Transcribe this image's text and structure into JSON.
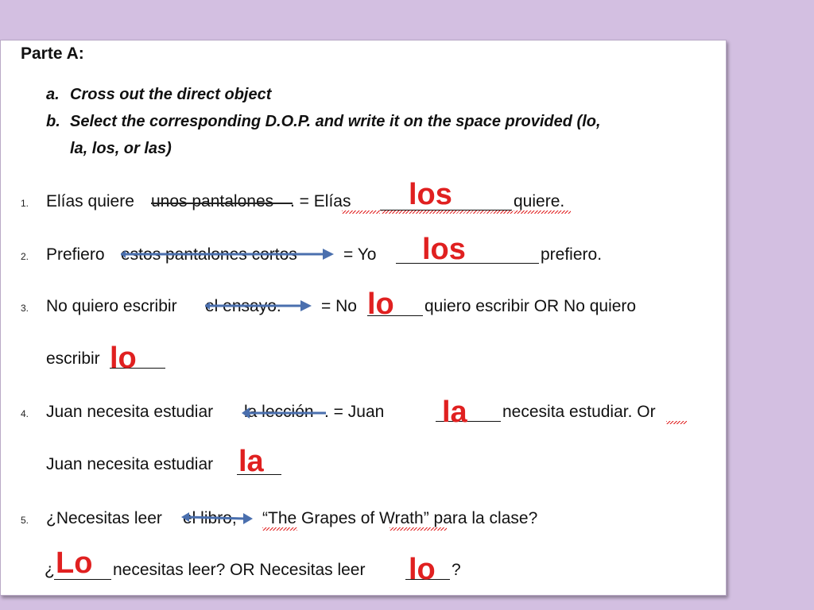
{
  "worksheet": {
    "heading": "Parte A:",
    "instructions": [
      {
        "label": "a.",
        "text": "Cross out the direct object"
      },
      {
        "label": "b.",
        "text": "Select the corresponding D.O.P. and write it on the space provided (lo,"
      },
      {
        "label": "",
        "text": "la, los, or las)"
      }
    ],
    "items": [
      {
        "number": "1.",
        "before": "Elías quiere",
        "struck": "unos pantalones",
        "after": ".  =   Elías",
        "tail": "quiere.",
        "answer": "los"
      },
      {
        "number": "2.",
        "before": "Prefiero",
        "struck": "estos pantalones cortos",
        "after": "=   Yo",
        "tail": "prefiero.",
        "answer": "los"
      },
      {
        "number": "3.",
        "before": "No quiero escribir",
        "struck": "el ensayo.",
        "after": "= No",
        "tail": "quiero escribir   OR   No quiero",
        "line2": "escribir",
        "answer": "lo",
        "answer2": "lo"
      },
      {
        "number": "4.",
        "before": "Juan necesita  estudiar",
        "struck": "la lección",
        "after": ".       =   Juan",
        "tail": "necesita estudiar.  Or",
        "line2": "Juan necesita  estudiar",
        "answer": "la",
        "answer2": "la"
      },
      {
        "number": "5.",
        "before": "¿Necesitas  leer",
        "struck": "el libro,",
        "after": "“The Grapes of Wrath” para la clase?",
        "line2_a": "¿",
        "line2_b": "necesitas leer?  OR  Necesitas  leer",
        "line2_c": "?",
        "answer": "Lo",
        "answer2": "lo"
      }
    ]
  }
}
